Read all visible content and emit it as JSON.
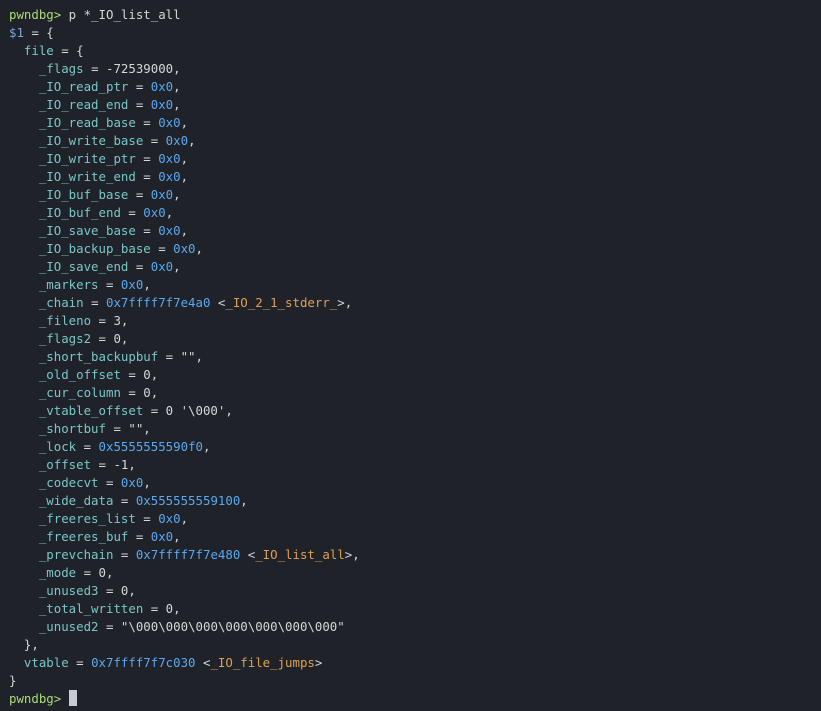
{
  "colors": {
    "background": "#1f2229",
    "prompt": "#a9dc76",
    "field_name": "#78c7c9",
    "address": "#5aa9f0",
    "symbol": "#e0a050",
    "text": "#d4d7dc"
  },
  "command": {
    "prompt": "pwndbg>",
    "text": " p *_IO_list_all"
  },
  "result_var": "$1",
  "open_brace": " = {",
  "file_key": "file",
  "fields": [
    {
      "name": "_flags",
      "value": "-72539000",
      "kind": "plain",
      "sym": ""
    },
    {
      "name": "_IO_read_ptr",
      "value": "0x0",
      "kind": "addr",
      "sym": ""
    },
    {
      "name": "_IO_read_end",
      "value": "0x0",
      "kind": "addr",
      "sym": ""
    },
    {
      "name": "_IO_read_base",
      "value": "0x0",
      "kind": "addr",
      "sym": ""
    },
    {
      "name": "_IO_write_base",
      "value": "0x0",
      "kind": "addr",
      "sym": ""
    },
    {
      "name": "_IO_write_ptr",
      "value": "0x0",
      "kind": "addr",
      "sym": ""
    },
    {
      "name": "_IO_write_end",
      "value": "0x0",
      "kind": "addr",
      "sym": ""
    },
    {
      "name": "_IO_buf_base",
      "value": "0x0",
      "kind": "addr",
      "sym": ""
    },
    {
      "name": "_IO_buf_end",
      "value": "0x0",
      "kind": "addr",
      "sym": ""
    },
    {
      "name": "_IO_save_base",
      "value": "0x0",
      "kind": "addr",
      "sym": ""
    },
    {
      "name": "_IO_backup_base",
      "value": "0x0",
      "kind": "addr",
      "sym": ""
    },
    {
      "name": "_IO_save_end",
      "value": "0x0",
      "kind": "addr",
      "sym": ""
    },
    {
      "name": "_markers",
      "value": "0x0",
      "kind": "addr",
      "sym": ""
    },
    {
      "name": "_chain",
      "value": "0x7ffff7f7e4a0",
      "kind": "addr",
      "sym": "_IO_2_1_stderr_"
    },
    {
      "name": "_fileno",
      "value": "3",
      "kind": "plain",
      "sym": ""
    },
    {
      "name": "_flags2",
      "value": "0",
      "kind": "plain",
      "sym": ""
    },
    {
      "name": "_short_backupbuf",
      "value": "\"\"",
      "kind": "plain",
      "sym": ""
    },
    {
      "name": "_old_offset",
      "value": "0",
      "kind": "plain",
      "sym": ""
    },
    {
      "name": "_cur_column",
      "value": "0",
      "kind": "plain",
      "sym": ""
    },
    {
      "name": "_vtable_offset",
      "value": "0 '\\000'",
      "kind": "plain",
      "sym": ""
    },
    {
      "name": "_shortbuf",
      "value": "\"\"",
      "kind": "plain",
      "sym": ""
    },
    {
      "name": "_lock",
      "value": "0x5555555590f0",
      "kind": "addr",
      "sym": ""
    },
    {
      "name": "_offset",
      "value": "-1",
      "kind": "plain",
      "sym": ""
    },
    {
      "name": "_codecvt",
      "value": "0x0",
      "kind": "addr",
      "sym": ""
    },
    {
      "name": "_wide_data",
      "value": "0x555555559100",
      "kind": "addr",
      "sym": ""
    },
    {
      "name": "_freeres_list",
      "value": "0x0",
      "kind": "addr",
      "sym": ""
    },
    {
      "name": "_freeres_buf",
      "value": "0x0",
      "kind": "addr",
      "sym": ""
    },
    {
      "name": "_prevchain",
      "value": "0x7ffff7f7e480",
      "kind": "addr",
      "sym": "_IO_list_all"
    },
    {
      "name": "_mode",
      "value": "0",
      "kind": "plain",
      "sym": ""
    },
    {
      "name": "_unused3",
      "value": "0",
      "kind": "plain",
      "sym": ""
    },
    {
      "name": "_total_written",
      "value": "0",
      "kind": "plain",
      "sym": ""
    },
    {
      "name": "_unused2",
      "value": "\"\\000\\000\\000\\000\\000\\000\\000\"",
      "kind": "plain",
      "sym": ""
    }
  ],
  "file_close": "},",
  "vtable": {
    "name": "vtable",
    "value": "0x7ffff7f7c030",
    "sym": "_IO_file_jumps"
  },
  "close_brace": "}",
  "final_prompt": "pwndbg>"
}
